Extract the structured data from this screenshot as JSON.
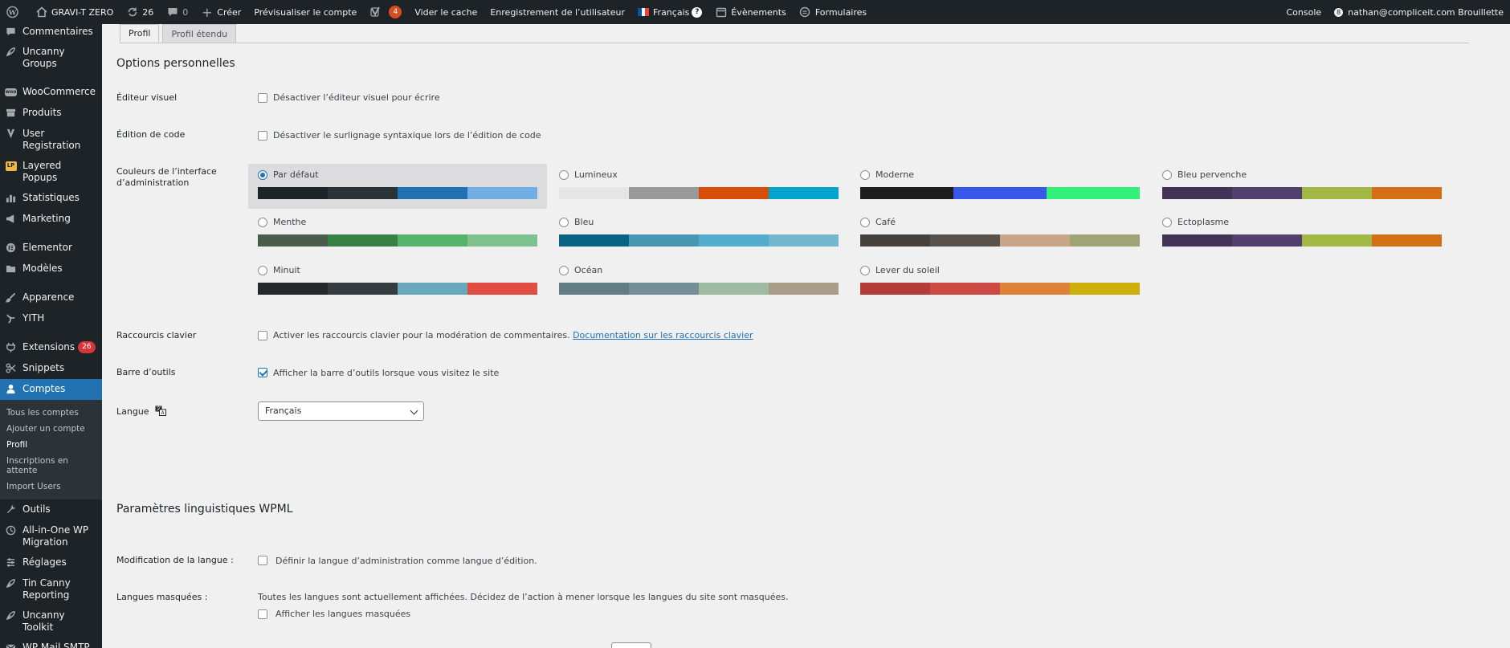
{
  "adminbar": {
    "site_name": "GRAVI-T ZERO",
    "updates_count": "26",
    "comments_count": "0",
    "new_label": "Créer",
    "preview_label": "Prévisualiser le compte",
    "yoast_badge": "4",
    "cache_label": "Vider le cache",
    "user_reg_label": "Enregistrement de l’utilisateur",
    "language_label": "Français",
    "events_label": "Évènements",
    "forms_label": "Formulaires",
    "console_label": "Console",
    "user_label": "nathan@compliceit.com Brouillette",
    "avatar_initial": "8"
  },
  "sidebar": {
    "items": [
      {
        "label": "Commentaires",
        "icon": "comment-icon"
      },
      {
        "label": "Uncanny Groups",
        "icon": "feather-icon"
      },
      {
        "label": "WooCommerce",
        "icon": "woocommerce-icon"
      },
      {
        "label": "Produits",
        "icon": "archive-icon"
      },
      {
        "label": "User Registration",
        "icon": "user-registration-icon"
      },
      {
        "label": "Layered Popups",
        "icon": "layered-popups-icon"
      },
      {
        "label": "Statistiques",
        "icon": "chart-icon"
      },
      {
        "label": "Marketing",
        "icon": "megaphone-icon"
      },
      {
        "label": "Elementor",
        "icon": "elementor-icon"
      },
      {
        "label": "Modèles",
        "icon": "folder-icon"
      },
      {
        "label": "Apparence",
        "icon": "brush-icon"
      },
      {
        "label": "YITH",
        "icon": "yith-icon"
      },
      {
        "label": "Extensions",
        "icon": "plugin-icon",
        "badge": "26"
      },
      {
        "label": "Snippets",
        "icon": "scissors-icon"
      },
      {
        "label": "Comptes",
        "icon": "user-icon"
      },
      {
        "label": "Outils",
        "icon": "wrench-icon"
      },
      {
        "label": "All-in-One WP Migration",
        "icon": "migration-icon"
      },
      {
        "label": "Réglages",
        "icon": "settings-icon"
      },
      {
        "label": "Tin Canny Reporting",
        "icon": "feather-icon"
      },
      {
        "label": "Uncanny Toolkit",
        "icon": "feather-icon"
      },
      {
        "label": "WP Mail SMTP",
        "icon": "mail-icon"
      }
    ],
    "submenu": [
      "Tous les comptes",
      "Ajouter un compte",
      "Profil",
      "Inscriptions en attente",
      "Import Users"
    ]
  },
  "tabs": [
    "Profil",
    "Profil étendu"
  ],
  "personal": {
    "heading": "Options personnelles",
    "visual_editor_label": "Éditeur visuel",
    "visual_editor_option": "Désactiver l’éditeur visuel pour écrire",
    "code_editing_label": "Édition de code",
    "code_editing_option": "Désactiver le surlignage syntaxique lors de l’édition de code",
    "admin_colors_label": "Couleurs de l’interface d’administration",
    "shortcuts_label": "Raccourcis clavier",
    "shortcuts_option": "Activer les raccourcis clavier pour la modération de commentaires.",
    "shortcuts_link": "Documentation sur les raccourcis clavier",
    "toolbar_label": "Barre d’outils",
    "toolbar_option": "Afficher la barre d’outils lorsque vous visitez le site",
    "language_label": "Langue",
    "language_value": "Français"
  },
  "color_schemes": [
    {
      "name": "Par défaut",
      "selected": true,
      "colors": [
        "#1d2327",
        "#2c3338",
        "#2271b1",
        "#72aee6"
      ]
    },
    {
      "name": "Lumineux",
      "selected": false,
      "colors": [
        "#e5e5e5",
        "#999999",
        "#d64e07",
        "#04a4cc"
      ]
    },
    {
      "name": "Moderne",
      "selected": false,
      "colors": [
        "#1e1e1e",
        "#3858e9",
        "#33f078"
      ]
    },
    {
      "name": "Bleu pervenche",
      "selected": false,
      "colors": [
        "#413256",
        "#523f6d",
        "#a3b745",
        "#d46f15"
      ]
    },
    {
      "name": "Menthe",
      "selected": false,
      "colors": [
        "#4a5c4b",
        "#368244",
        "#56b36c",
        "#7fc18f"
      ]
    },
    {
      "name": "Bleu",
      "selected": false,
      "colors": [
        "#096484",
        "#4796b3",
        "#52accc",
        "#74b6ce"
      ]
    },
    {
      "name": "Café",
      "selected": false,
      "colors": [
        "#46403c",
        "#59524c",
        "#c7a589",
        "#9ea476"
      ]
    },
    {
      "name": "Ectoplasme",
      "selected": false,
      "colors": [
        "#413256",
        "#523f6d",
        "#a3b745",
        "#d46f15"
      ]
    },
    {
      "name": "Minuit",
      "selected": false,
      "colors": [
        "#25282b",
        "#363b3f",
        "#69a8bb",
        "#e14d43"
      ]
    },
    {
      "name": "Océan",
      "selected": false,
      "colors": [
        "#627c83",
        "#738e96",
        "#9ebaa0",
        "#aa9d88"
      ]
    },
    {
      "name": "Lever du soleil",
      "selected": false,
      "colors": [
        "#b43c38",
        "#cf4944",
        "#dd823b",
        "#ccaf0b"
      ]
    }
  ],
  "wpml": {
    "heading": "Paramètres linguistiques WPML",
    "lang_change_label": "Modification de la langue :",
    "lang_change_option": "Définir la langue d’administration comme langue d’édition.",
    "hidden_label": "Langues masquées :",
    "hidden_text": "Toutes les langues sont actuellement affichées. Décidez de l’action à mener lorsque les langues du site sont masquées.",
    "hidden_option": "Afficher les langues masquées"
  }
}
